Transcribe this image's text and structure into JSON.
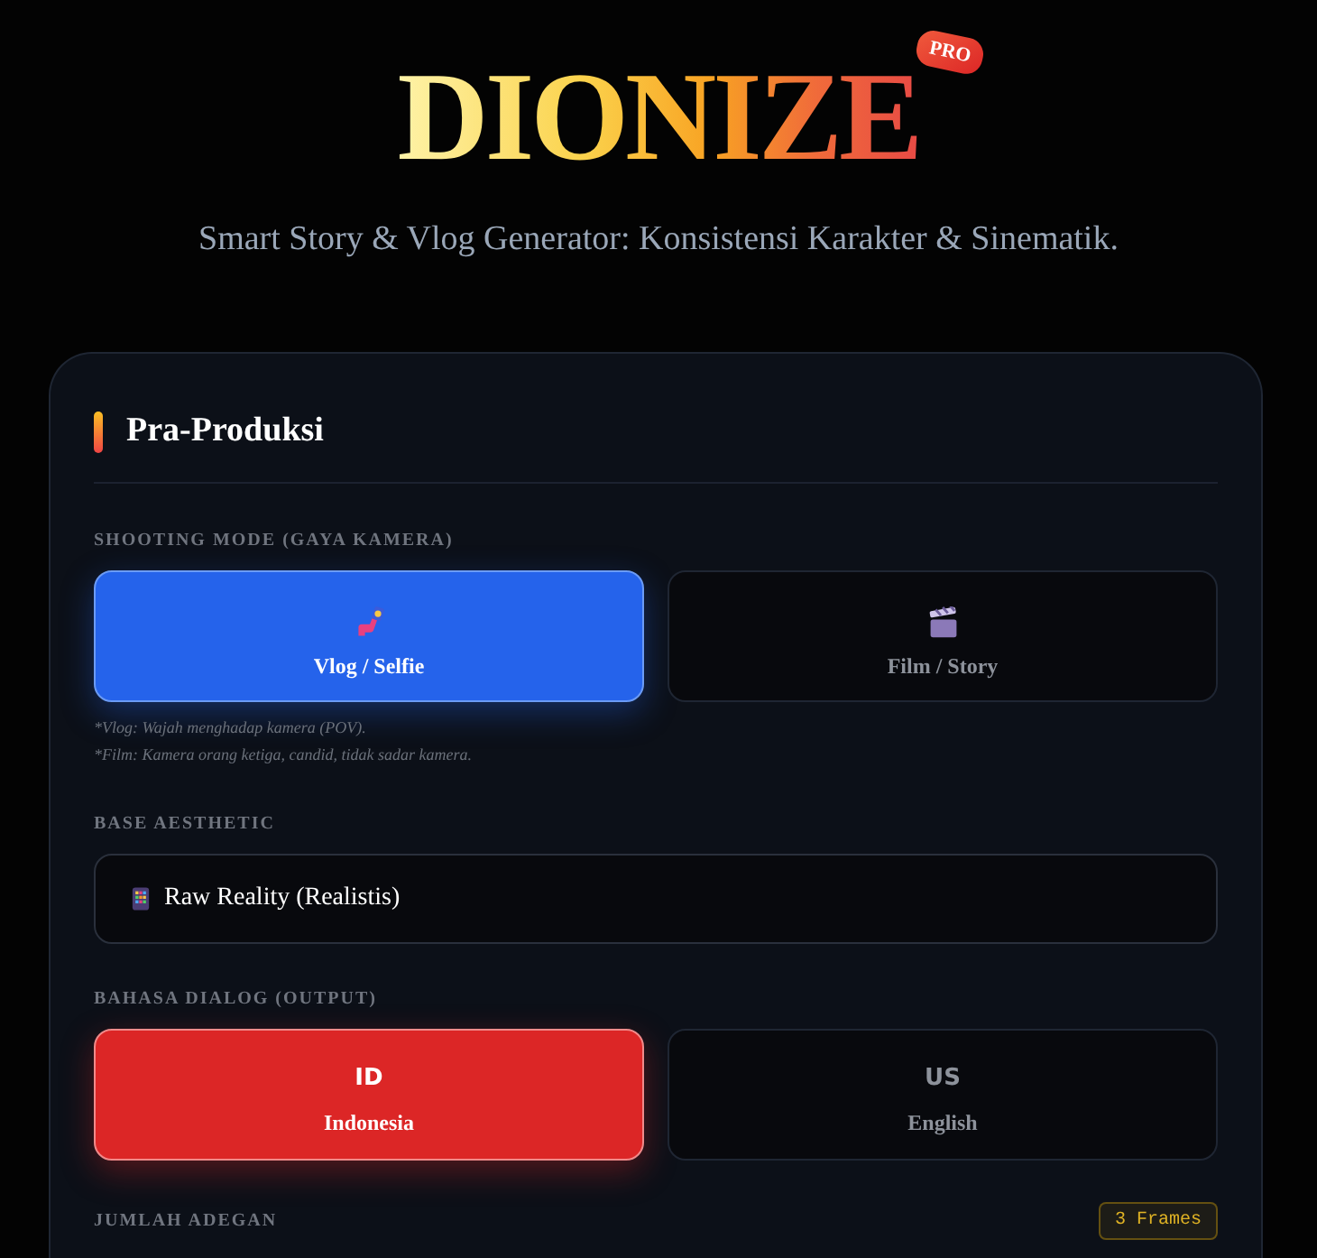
{
  "header": {
    "logo": "DIONIZE",
    "badge": "PRO",
    "subtitle": "Smart Story & Vlog Generator: Konsistensi Karakter & Sinematik."
  },
  "panel": {
    "title": "Pra-Produksi",
    "shooting_mode": {
      "label": "SHOOTING MODE (GAYA KAMERA)",
      "options": [
        {
          "kind": "vlog",
          "label": "Vlog / Selfie",
          "selected": true
        },
        {
          "kind": "film",
          "label": "Film / Story",
          "selected": false
        }
      ],
      "notes": [
        "*Vlog: Wajah menghadap kamera (POV).",
        "*Film: Kamera orang ketiga, candid, tidak sadar kamera."
      ]
    },
    "base_aesthetic": {
      "label": "BASE AESTHETIC",
      "value": "Raw Reality (Realistis)"
    },
    "dialog_language": {
      "label": "BAHASA DIALOG (OUTPUT)",
      "options": [
        {
          "code": "ID",
          "label": "Indonesia",
          "selected": true
        },
        {
          "code": "US",
          "label": "English",
          "selected": false
        }
      ]
    },
    "scene_count": {
      "label": "JUMLAH ADEGAN",
      "value": "3 Frames"
    }
  }
}
